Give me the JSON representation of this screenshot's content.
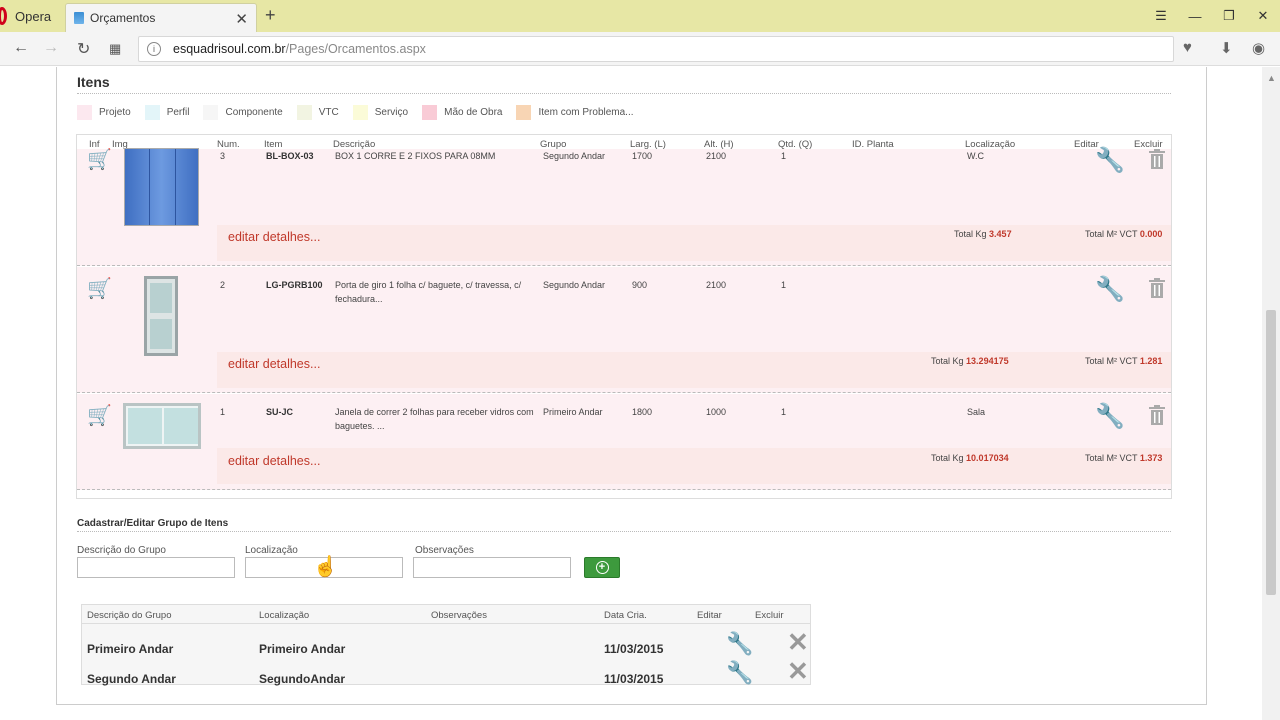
{
  "browser": {
    "menu_label": "Opera",
    "tab_title": "Orçamentos",
    "url_host": "esquadrisoul.com.br",
    "url_path": "/Pages/Orcamentos.aspx"
  },
  "items_section": {
    "title": "Itens",
    "legend": [
      {
        "label": "Projeto",
        "color": "#fce8ef"
      },
      {
        "label": "Perfil",
        "color": "#e3f5f9"
      },
      {
        "label": "Componente",
        "color": "#f6f6f6"
      },
      {
        "label": "VTC",
        "color": "#f2f4e2"
      },
      {
        "label": "Serviço",
        "color": "#fbfbd8"
      },
      {
        "label": "Mão de Obra",
        "color": "#f9cbd6"
      },
      {
        "label": "Item com Problema...",
        "color": "#f8d5b4"
      }
    ],
    "headers": {
      "inf": "Inf",
      "img": "Img",
      "num": "Num.",
      "item": "Item",
      "descricao": "Descrição",
      "grupo": "Grupo",
      "larg": "Larg. (L)",
      "alt": "Alt. (H)",
      "qtd": "Qtd. (Q)",
      "id_planta": "ID. Planta",
      "localizacao": "Localização",
      "editar": "Editar",
      "excluir": "Excluir"
    },
    "rows": [
      {
        "num": "3",
        "item": "BL-BOX-03",
        "descricao": "BOX 1 CORRE E 2 FIXOS PARA 08MM",
        "grupo": "Segundo Andar",
        "larg": "1700",
        "alt": "2100",
        "qtd": "1",
        "localizacao": "W.C",
        "edit_link": "editar detalhes...",
        "total_kg_label": "Total Kg",
        "total_kg": "3.457",
        "total_m2_label": "Total M² VCT",
        "total_m2": "0.000"
      },
      {
        "num": "2",
        "item": "LG-PGRB100",
        "descricao": "Porta de giro 1 folha c/ baguete, c/ travessa, c/ fechadura...",
        "grupo": "Segundo Andar",
        "larg": "900",
        "alt": "2100",
        "qtd": "1",
        "localizacao": "",
        "edit_link": "editar detalhes...",
        "total_kg_label": "Total Kg",
        "total_kg": "13.294175",
        "total_m2_label": "Total M² VCT",
        "total_m2": "1.281"
      },
      {
        "num": "1",
        "item": "SU-JC",
        "descricao": "Janela de correr 2 folhas para receber vidros com baguetes. ...",
        "grupo": "Primeiro Andar",
        "larg": "1800",
        "alt": "1000",
        "qtd": "1",
        "localizacao": "Sala",
        "edit_link": "editar detalhes...",
        "total_kg_label": "Total Kg",
        "total_kg": "10.017034",
        "total_m2_label": "Total M² VCT",
        "total_m2": "1.373"
      }
    ]
  },
  "group_form": {
    "title": "Cadastrar/Editar Grupo de Itens",
    "descricao_label": "Descrição do Grupo",
    "localizacao_label": "Localização",
    "observacoes_label": "Observações",
    "descricao_value": "",
    "localizacao_value": "",
    "observacoes_value": ""
  },
  "group_table": {
    "headers": {
      "descricao": "Descrição do Grupo",
      "localizacao": "Localização",
      "observacoes": "Observações",
      "data": "Data Cria.",
      "editar": "Editar",
      "excluir": "Excluir"
    },
    "rows": [
      {
        "descricao": "Primeiro Andar",
        "localizacao": "Primeiro Andar",
        "observacoes": "",
        "data": "11/03/2015"
      },
      {
        "descricao": "Segundo Andar",
        "localizacao": "SegundoAndar",
        "observacoes": "",
        "data": "11/03/2015"
      }
    ]
  }
}
